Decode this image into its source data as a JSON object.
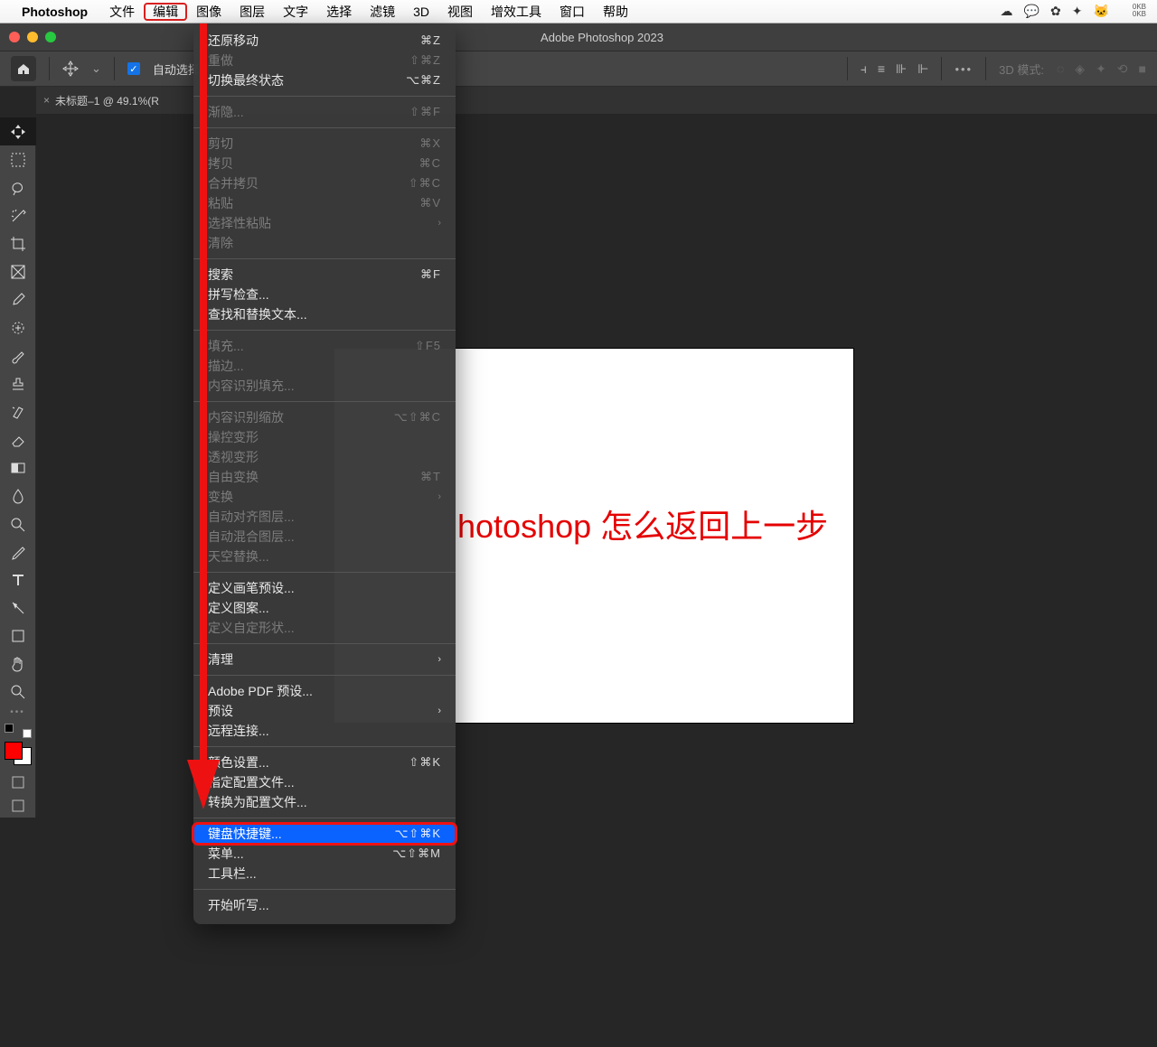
{
  "menubar": {
    "appname": "Photoshop",
    "items": [
      "文件",
      "编辑",
      "图像",
      "图层",
      "文字",
      "选择",
      "滤镜",
      "3D",
      "视图",
      "增效工具",
      "窗口",
      "帮助"
    ],
    "highlight_index": 1,
    "sysicons": [
      "☁",
      "💬",
      "✿",
      "✦",
      "🐱"
    ],
    "stacked": [
      "0KB",
      "0KB"
    ]
  },
  "window": {
    "title": "Adobe Photoshop 2023"
  },
  "optionsbar": {
    "auto_select_label": "自动选择:",
    "threed_label": "3D 模式:"
  },
  "doctab": {
    "label": "未标题–1 @ 49.1%(R"
  },
  "canvas_text": "hotoshop 怎么返回上一步",
  "menu_groups": [
    [
      {
        "label": "还原移动",
        "shortcut": "⌘Z",
        "disabled": false
      },
      {
        "label": "重做",
        "shortcut": "⇧⌘Z",
        "disabled": true
      },
      {
        "label": "切换最终状态",
        "shortcut": "⌥⌘Z",
        "disabled": false
      }
    ],
    [
      {
        "label": "渐隐...",
        "shortcut": "⇧⌘F",
        "disabled": true
      }
    ],
    [
      {
        "label": "剪切",
        "shortcut": "⌘X",
        "disabled": true
      },
      {
        "label": "拷贝",
        "shortcut": "⌘C",
        "disabled": true
      },
      {
        "label": "合并拷贝",
        "shortcut": "⇧⌘C",
        "disabled": true
      },
      {
        "label": "粘贴",
        "shortcut": "⌘V",
        "disabled": true
      },
      {
        "label": "选择性粘贴",
        "submenu": true,
        "disabled": true
      },
      {
        "label": "清除",
        "disabled": true
      }
    ],
    [
      {
        "label": "搜索",
        "shortcut": "⌘F",
        "disabled": false
      },
      {
        "label": "拼写检查...",
        "disabled": false
      },
      {
        "label": "查找和替换文本...",
        "disabled": false
      }
    ],
    [
      {
        "label": "填充...",
        "shortcut": "⇧F5",
        "disabled": true
      },
      {
        "label": "描边...",
        "disabled": true
      },
      {
        "label": "内容识别填充...",
        "disabled": true
      }
    ],
    [
      {
        "label": "内容识别缩放",
        "shortcut": "⌥⇧⌘C",
        "disabled": true
      },
      {
        "label": "操控变形",
        "disabled": true
      },
      {
        "label": "透视变形",
        "disabled": true
      },
      {
        "label": "自由变换",
        "shortcut": "⌘T",
        "disabled": true
      },
      {
        "label": "变换",
        "submenu": true,
        "disabled": true
      },
      {
        "label": "自动对齐图层...",
        "disabled": true
      },
      {
        "label": "自动混合图层...",
        "disabled": true
      },
      {
        "label": "天空替换...",
        "disabled": true
      }
    ],
    [
      {
        "label": "定义画笔预设...",
        "disabled": false
      },
      {
        "label": "定义图案...",
        "disabled": false
      },
      {
        "label": "定义自定形状...",
        "disabled": true
      }
    ],
    [
      {
        "label": "清理",
        "submenu": true,
        "disabled": false
      }
    ],
    [
      {
        "label": "Adobe PDF 预设...",
        "disabled": false
      },
      {
        "label": "预设",
        "submenu": true,
        "disabled": false
      },
      {
        "label": "远程连接...",
        "disabled": false
      }
    ],
    [
      {
        "label": "颜色设置...",
        "shortcut": "⇧⌘K",
        "disabled": false
      },
      {
        "label": "指定配置文件...",
        "disabled": false
      },
      {
        "label": "转换为配置文件...",
        "disabled": false
      }
    ],
    [
      {
        "label": "键盘快捷键...",
        "shortcut": "⌥⇧⌘K",
        "disabled": false,
        "highlighted": true,
        "boxed": true
      },
      {
        "label": "菜单...",
        "shortcut": "⌥⇧⌘M",
        "disabled": false
      },
      {
        "label": "工具栏...",
        "disabled": false
      }
    ],
    [
      {
        "label": "开始听写...",
        "disabled": false
      }
    ]
  ],
  "tool_icons": [
    "move",
    "marquee",
    "lasso",
    "wand",
    "crop",
    "frame",
    "eyedropper",
    "heal",
    "brush",
    "stamp",
    "history",
    "eraser",
    "gradient",
    "blur",
    "dodge",
    "pen",
    "type",
    "path",
    "shape",
    "hand",
    "zoom"
  ]
}
